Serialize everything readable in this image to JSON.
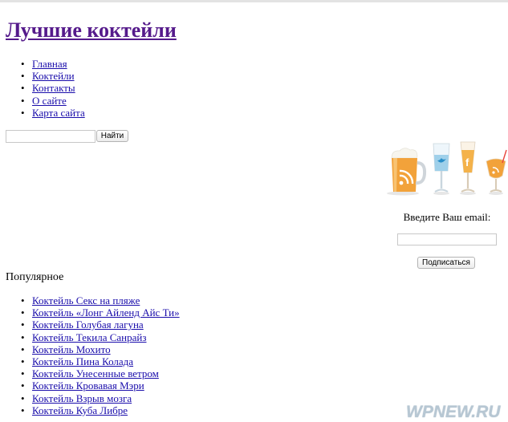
{
  "site": {
    "title": "Лучшие коктейли"
  },
  "nav": {
    "items": [
      {
        "label": "Главная"
      },
      {
        "label": "Коктейли"
      },
      {
        "label": "Контакты"
      },
      {
        "label": "О сайте"
      },
      {
        "label": "Карта сайта"
      }
    ]
  },
  "search": {
    "value": "",
    "button_label": "Найти"
  },
  "subscribe": {
    "label": "Введите Ваш email:",
    "value": "",
    "button_label": "Подписаться",
    "icons": [
      "rss-beer-glass-icon",
      "twitter-glass-icon",
      "facebook-glass-icon",
      "rss-cocktail-glass-icon"
    ]
  },
  "popular": {
    "title": "Популярное",
    "items": [
      {
        "label": "Коктейль Секс на пляже"
      },
      {
        "label": "Коктейль «Лонг Айленд Айс Ти»"
      },
      {
        "label": "Коктейль Голубая лагуна"
      },
      {
        "label": "Коктейль Текила Санрайз"
      },
      {
        "label": "Коктейль Мохито"
      },
      {
        "label": "Коктейль Пина Колада"
      },
      {
        "label": "Коктейль Унесенные ветром"
      },
      {
        "label": "Коктейль Кровавая Мэри"
      },
      {
        "label": "Коктейль Взрыв мозга"
      },
      {
        "label": "Коктейль Куба Либре"
      }
    ]
  },
  "watermark": {
    "text": "WPNEW.RU"
  },
  "colors": {
    "link": "#1a0dab",
    "visited": "#551a8b",
    "beer": "#f2a23a"
  }
}
